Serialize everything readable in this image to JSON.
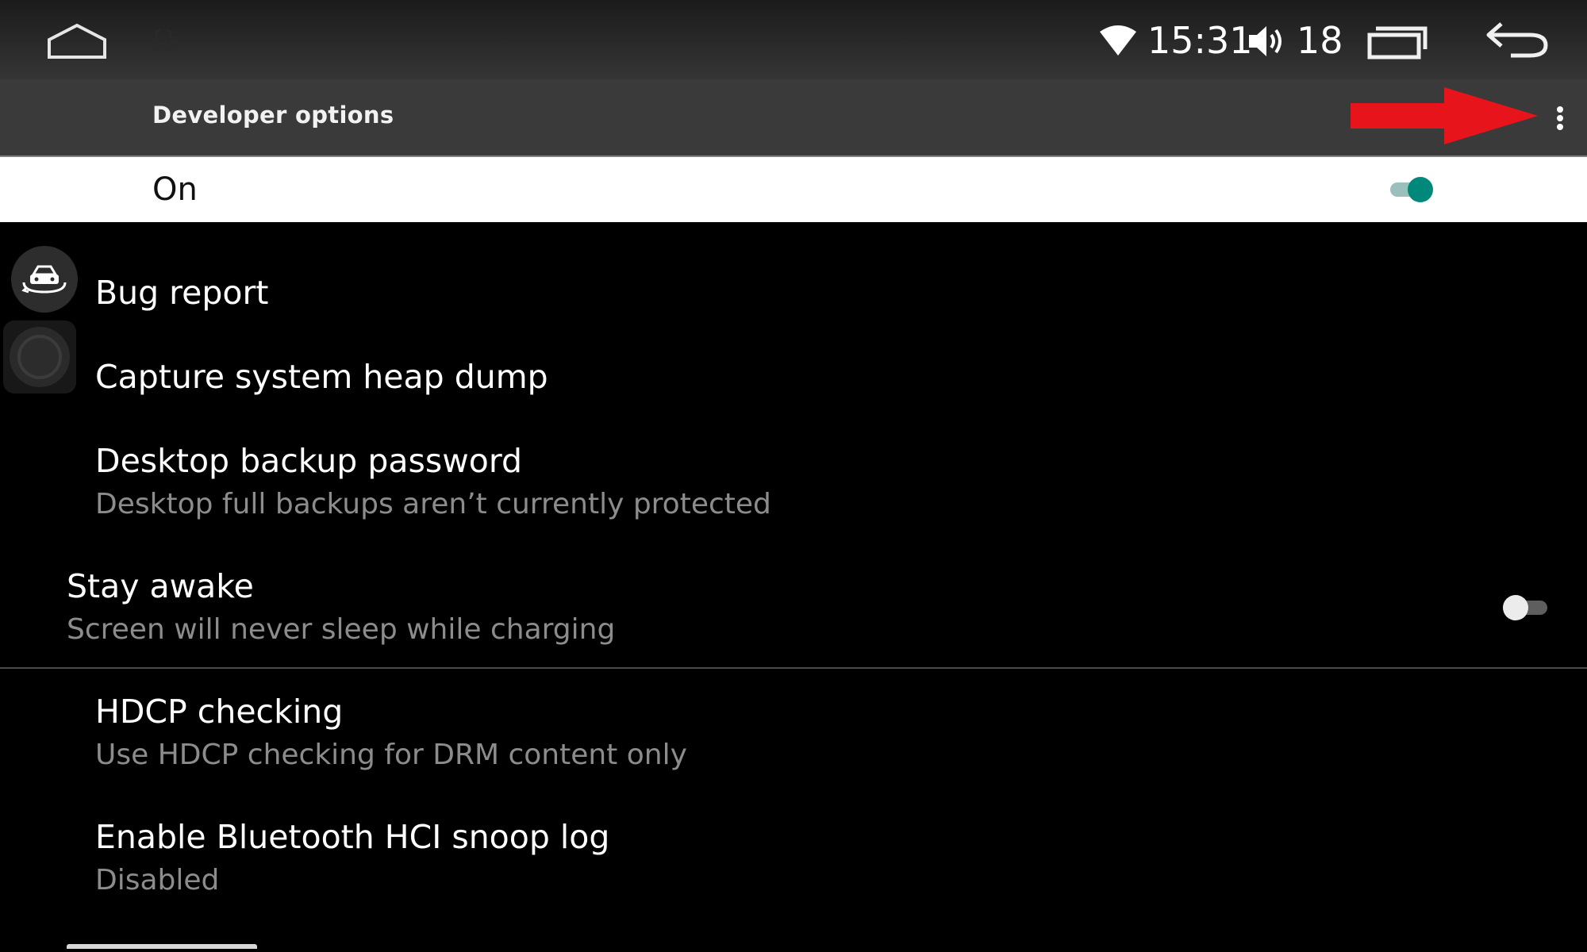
{
  "status_bar": {
    "time": "15:31",
    "volume_level": "18",
    "icons": [
      "home-icon",
      "braces-icon",
      "wifi-icon",
      "volume-icon",
      "recent-apps-icon",
      "back-icon"
    ]
  },
  "action_bar": {
    "title": "Developer options",
    "overflow_icon": "more-vert-icon",
    "annotation_arrow_color": "#e8141c"
  },
  "master_switch": {
    "label": "On",
    "checked": true,
    "accent_color": "#00897b"
  },
  "floating_buttons": {
    "icons": [
      "car-360-icon",
      "assistive-touch-icon"
    ]
  },
  "settings": [
    {
      "title": "Bug report",
      "summary": ""
    },
    {
      "title": "Capture system heap dump",
      "summary": ""
    },
    {
      "title": "Desktop backup password",
      "summary": "Desktop full backups aren’t currently protected"
    },
    {
      "title": "Stay awake",
      "summary": "Screen will never sleep while charging",
      "toggle": false
    },
    {
      "title": "HDCP checking",
      "summary": "Use HDCP checking for DRM content only"
    },
    {
      "title": "Enable Bluetooth HCI snoop log",
      "summary": "Disabled"
    }
  ]
}
